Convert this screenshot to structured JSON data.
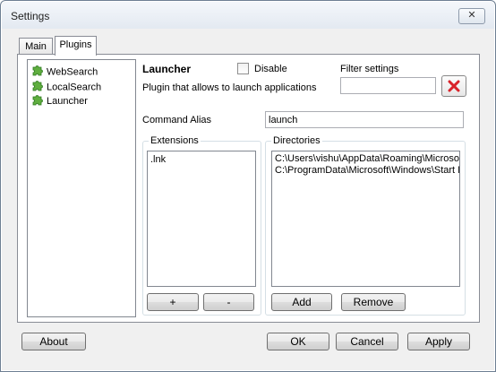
{
  "window": {
    "title": "Settings",
    "close_glyph": "✕"
  },
  "tabs": [
    {
      "label": "Main",
      "active": false
    },
    {
      "label": "Plugins",
      "active": true
    }
  ],
  "plugins": {
    "items": [
      {
        "label": "WebSearch",
        "icon": "puzzle-piece-icon"
      },
      {
        "label": "LocalSearch",
        "icon": "puzzle-piece-icon"
      },
      {
        "label": "Launcher",
        "icon": "puzzle-piece-icon",
        "selected": true
      }
    ]
  },
  "plugin_detail": {
    "name": "Launcher",
    "disable_label": "Disable",
    "disable_checked": false,
    "description": "Plugin that allows to launch applications",
    "filter_label": "Filter settings",
    "filter_value": "",
    "command_alias_label": "Command Alias",
    "command_alias_value": "launch"
  },
  "extensions": {
    "title": "Extensions",
    "items": [
      ".lnk"
    ],
    "add_label": "+",
    "remove_label": "-"
  },
  "directories": {
    "title": "Directories",
    "items": [
      "C:\\Users\\vishu\\AppData\\Roaming\\Microsof",
      "C:\\ProgramData\\Microsoft\\Windows\\Start M"
    ],
    "add_label": "Add",
    "remove_label": "Remove"
  },
  "footer": {
    "about_label": "About",
    "ok_label": "OK",
    "cancel_label": "Cancel",
    "apply_label": "Apply"
  },
  "colors": {
    "accent_red": "#d9232a",
    "plugin_icon_green": "#5fae3f"
  }
}
